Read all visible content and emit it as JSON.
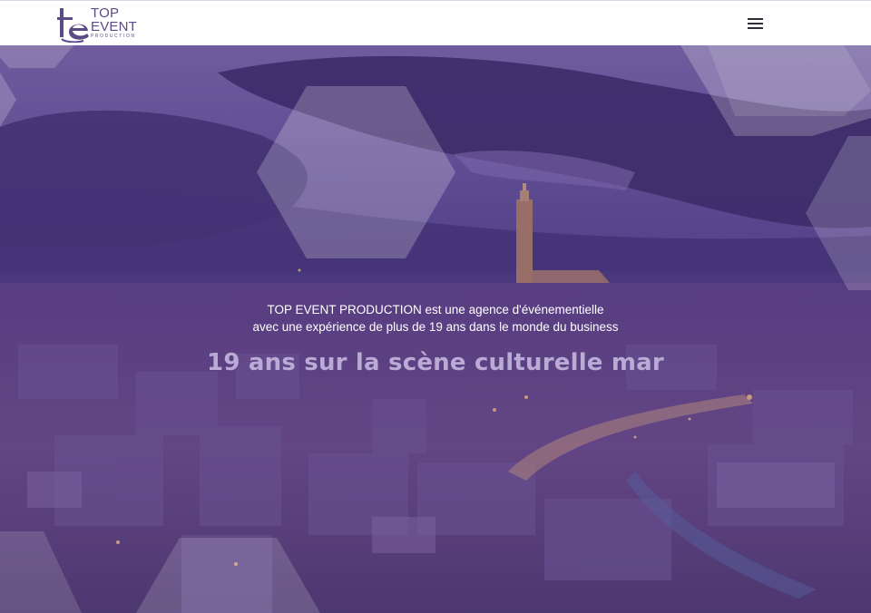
{
  "header": {
    "logo": {
      "mark": "te",
      "line1": "TOP",
      "line2": "EVENT",
      "line3": "PRODUCTION"
    },
    "menu_icon": "hamburger-menu-icon"
  },
  "hero": {
    "intro_line1": "TOP EVENT PRODUCTION est une agence d'événementielle",
    "intro_line2": "avec une expérience de plus de 19 ans dans le monde du business",
    "tagline": "19 ans sur la scène culturelle mar"
  },
  "colors": {
    "brand": "#5a4a86",
    "overlay": "#4f3a86",
    "tagline": "#b9aad6",
    "header_bg": "#ffffff"
  }
}
